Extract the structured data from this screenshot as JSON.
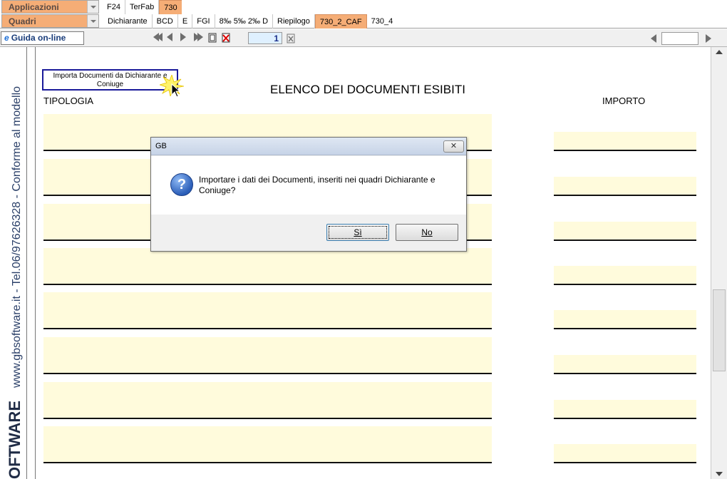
{
  "menus": {
    "applicazioni": "Applicazioni",
    "quadri": "Quadri"
  },
  "top_tabs": [
    "F24",
    "TerFab",
    "730"
  ],
  "sub_tabs": [
    "Dichiarante",
    "BCD",
    "E",
    "FGI",
    "8‰  5‰ 2‰ D",
    "Riepilogo",
    "730_2_CAF",
    "730_4"
  ],
  "toolbar": {
    "guida_label": "Guida on-line",
    "page_number": "1"
  },
  "sidebar": {
    "brand": "OFTWARE",
    "contact": "www.gbsoftware.it - Tel.06/97626328 - Conforme al modello"
  },
  "form": {
    "import_button": "Importa Documenti da Dichiarante e Coniuge",
    "title": "ELENCO DEI DOCUMENTI ESIBITI",
    "col_tipologia": "TIPOLOGIA",
    "col_importo": "IMPORTO"
  },
  "dialog": {
    "title": "GB",
    "close": "✕",
    "message": "Importare i dati dei Documenti, inseriti nei quadri Dichiarante e Coniuge?",
    "yes": "Sì",
    "no": "No"
  },
  "colors": {
    "accent_tab": "#f5ad76",
    "field_bg": "#fffbdc"
  }
}
